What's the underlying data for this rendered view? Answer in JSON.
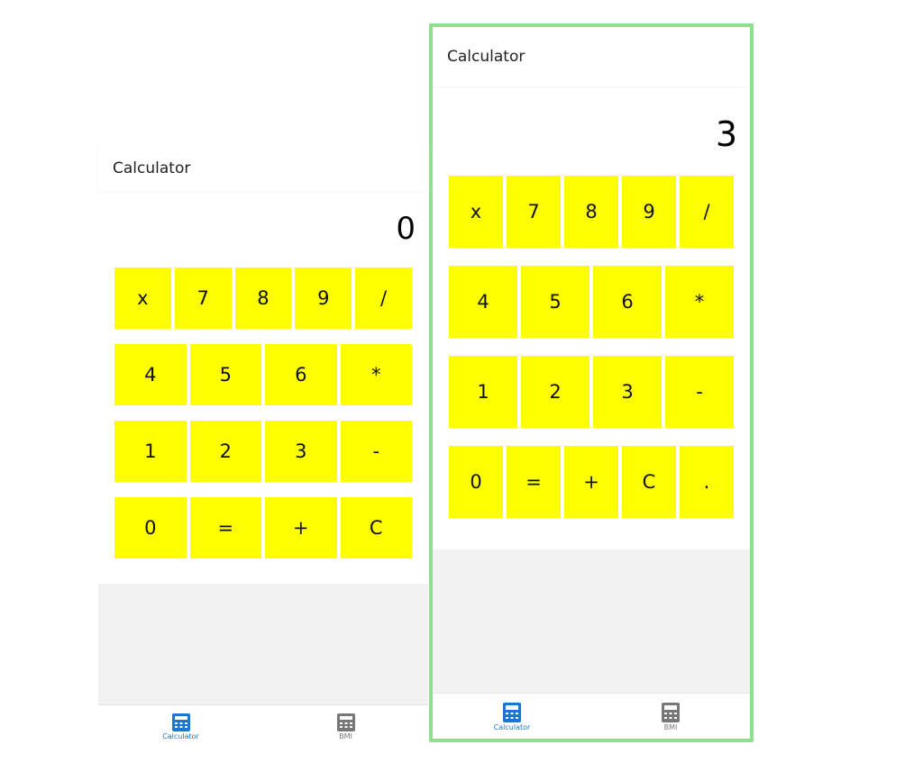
{
  "left_screen": {
    "app_title": "Calculator",
    "display_value": "0",
    "rows": [
      [
        "x",
        "7",
        "8",
        "9",
        "/"
      ],
      [
        "4",
        "5",
        "6",
        "*"
      ],
      [
        "1",
        "2",
        "3",
        "-"
      ],
      [
        "0",
        "=",
        "+",
        "C"
      ]
    ],
    "nav": [
      {
        "label": "Calculator",
        "icon": "calculator-icon",
        "active": true
      },
      {
        "label": "BMI",
        "icon": "calculator-icon",
        "active": false
      }
    ]
  },
  "right_screen": {
    "app_title": "Calculator",
    "display_value": "3",
    "rows": [
      [
        "x",
        "7",
        "8",
        "9",
        "/"
      ],
      [
        "4",
        "5",
        "6",
        "*"
      ],
      [
        "1",
        "2",
        "3",
        "-"
      ],
      [
        "0",
        "=",
        "+",
        "C",
        "."
      ]
    ],
    "nav": [
      {
        "label": "Calculator",
        "icon": "calculator-icon",
        "active": true
      },
      {
        "label": "BMI",
        "icon": "calculator-icon",
        "active": false
      }
    ]
  },
  "colors": {
    "key_background": "#ffff00",
    "active_nav": "#1976d2",
    "inactive_nav": "#777777",
    "highlight_border": "#8ee08e"
  }
}
